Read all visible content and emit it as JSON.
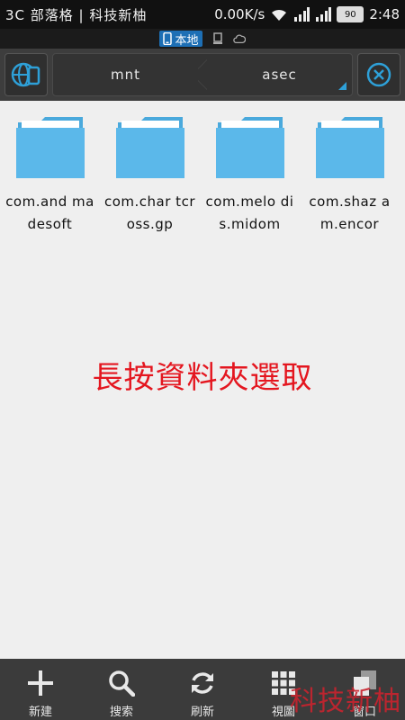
{
  "status_bar": {
    "carrier": "3C 部落格 | 科技新柚",
    "speed": "0.00K/s",
    "battery": "90",
    "time": "2:48"
  },
  "tabs": {
    "local_label": "本地"
  },
  "path": {
    "crumbs": [
      "mnt",
      "asec"
    ]
  },
  "folders": [
    {
      "name": "com.and madesoft"
    },
    {
      "name": "com.char tcross.gp"
    },
    {
      "name": "com.melo dis.midom"
    },
    {
      "name": "com.shaz am.encor"
    }
  ],
  "hint_text": "長按資料夾選取",
  "toolbar": {
    "new_label": "新建",
    "search_label": "搜索",
    "refresh_label": "刷新",
    "view_label": "視圖",
    "windows_label": "窗口"
  },
  "watermark": "科技新柚",
  "colors": {
    "accent": "#2ea0d8",
    "folder": "#5bb8ea",
    "hint": "#e4161f"
  }
}
